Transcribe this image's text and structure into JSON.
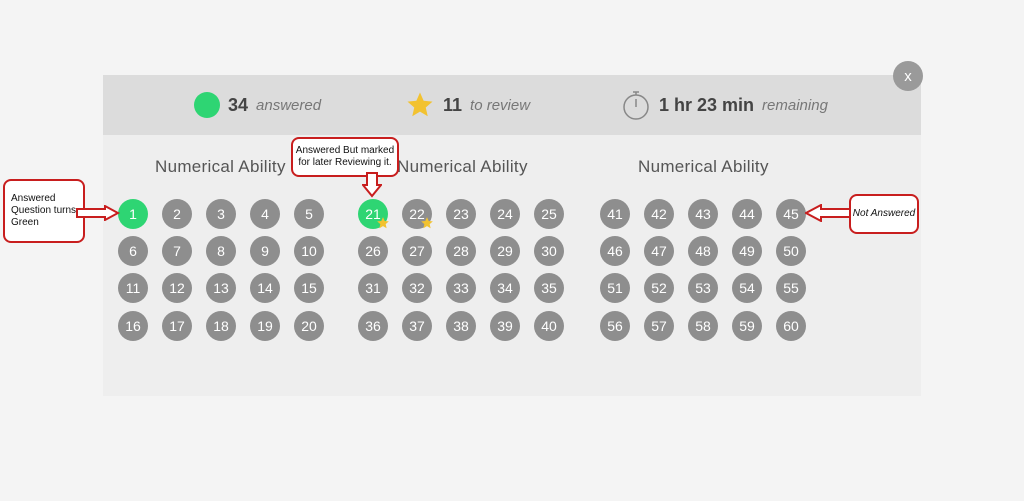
{
  "summary": {
    "answered_count": "34",
    "answered_label": "answered",
    "review_count": "11",
    "review_label": "to review",
    "time_value": "1 hr 23 min",
    "time_label": "remaining"
  },
  "close_label": "x",
  "groups": [
    {
      "title": "Numerical Ability"
    },
    {
      "title": "Numerical Ability"
    },
    {
      "title": "Numerical Ability"
    }
  ],
  "questions": [
    "1",
    "2",
    "3",
    "4",
    "5",
    "6",
    "7",
    "8",
    "9",
    "10",
    "11",
    "12",
    "13",
    "14",
    "15",
    "16",
    "17",
    "18",
    "19",
    "20",
    "21",
    "22",
    "23",
    "24",
    "25",
    "26",
    "27",
    "28",
    "29",
    "30",
    "31",
    "32",
    "33",
    "34",
    "35",
    "36",
    "37",
    "38",
    "39",
    "40",
    "41",
    "42",
    "43",
    "44",
    "45",
    "46",
    "47",
    "48",
    "49",
    "50",
    "51",
    "52",
    "53",
    "54",
    "55",
    "56",
    "57",
    "58",
    "59",
    "60"
  ],
  "answered_questions": [
    "1",
    "21"
  ],
  "review_questions": [
    "21",
    "22"
  ],
  "annotations": {
    "answered_note": "Answered Question turns Green",
    "review_note": "Answered But marked for later Reviewing it.",
    "not_answered_note": "Not Answered"
  },
  "colors": {
    "answered": "#2ed573",
    "unanswered": "#8e8e8e",
    "star": "#f2c230",
    "callout_border": "#c81e1e"
  }
}
